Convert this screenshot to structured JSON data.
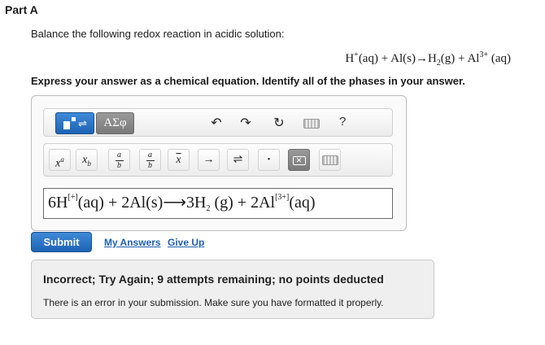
{
  "part": {
    "title": "Part A"
  },
  "question": {
    "instruction": "Balance the following redox reaction in acidic solution:",
    "reaction": {
      "h": "H",
      "h_charge": "+",
      "aq1": "(aq)",
      "plus1": "+",
      "al_s": "Al(s)",
      "arrow": "→",
      "h2": "H",
      "h2_sub": "2",
      "g": "(g)",
      "plus2": "+",
      "al": "Al",
      "al_charge": "3+",
      "aq2": "(aq)"
    },
    "express": "Express your answer as a chemical equation. Identify all of the phases in your answer."
  },
  "toolbar": {
    "greek_label": "ΑΣφ",
    "undo": "↶",
    "redo": "↷",
    "reset": "↻",
    "help": "?"
  },
  "palette": {
    "superscript": {
      "base": "x",
      "sup": "a"
    },
    "subscript": {
      "base": "x",
      "sub": "b"
    },
    "fraction": {
      "num": "a",
      "den": "b"
    },
    "fraction2": {
      "num": "a",
      "den": "b"
    },
    "overline": "x",
    "arrow": "→",
    "equilibrium": "⇌",
    "dot": "•",
    "backspace": "✕"
  },
  "answer": {
    "p1": "6H",
    "q1": "[+]",
    "p2": "(aq) + 2Al(s)⟶3H",
    "s1": "2",
    "p3": " (g) + 2Al",
    "q2": "[3+]",
    "p4": "(aq)"
  },
  "actions": {
    "submit": "Submit",
    "my_answers": "My Answers",
    "give_up": "Give Up"
  },
  "feedback": {
    "title": "Incorrect; Try Again; 9 attempts remaining; no points deducted",
    "message": "There is an error in your submission. Make sure you have formatted it properly."
  }
}
